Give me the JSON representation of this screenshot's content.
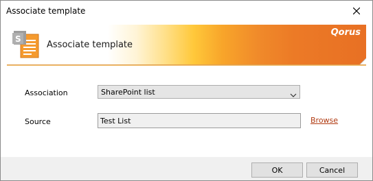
{
  "window": {
    "title": "Associate template"
  },
  "banner": {
    "title": "Associate template",
    "brand": "Qorus",
    "icon": "sharepoint-document-icon"
  },
  "form": {
    "association_label": "Association",
    "association_value": "SharePoint list",
    "source_label": "Source",
    "source_value": "Test List",
    "browse_label": "Browse"
  },
  "footer": {
    "ok_label": "OK",
    "cancel_label": "Cancel"
  },
  "colors": {
    "accent": "#e87024",
    "link": "#b03a10"
  }
}
